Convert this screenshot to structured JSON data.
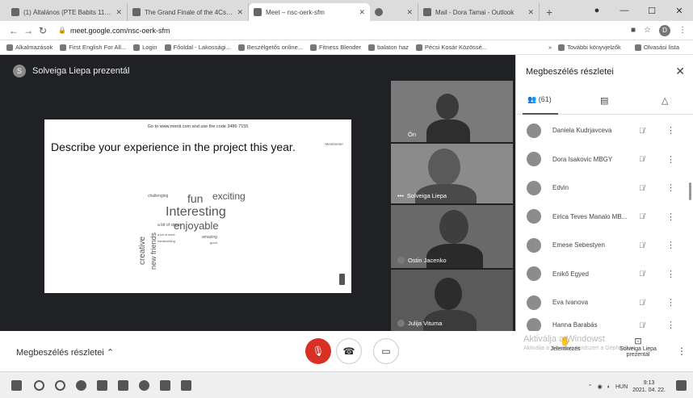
{
  "browser": {
    "tabs": [
      {
        "title": "(1) Általános (PTE Babits 11.DE ..."
      },
      {
        "title": "The Grand Finale of the 4Cs dig..."
      },
      {
        "title": "Meet – nsc-oerk-sfm"
      },
      {
        "title": ""
      },
      {
        "title": "Mail - Dora Tamai - Outlook"
      }
    ],
    "url": "meet.google.com/nsc-oerk-sfm",
    "bookmarks": [
      "Alkalmazások",
      "First English For All...",
      "Login",
      "Főoldal - Lakossági...",
      "Beszélgetős online...",
      "Fitness Blender",
      "balaton haz",
      "Pécsi Kosár Közössé..."
    ],
    "bookmarks_more": "»",
    "other_bookmarks": "További könyvjelzők",
    "reading_list": "Olvasási lista"
  },
  "meet": {
    "presenter_initial": "S",
    "presenter_label": "Solveiga Liepa prezentál",
    "slide": {
      "top_text": "Go to www.menti.com and use the code 3486 7155",
      "brand": "Mentimeter",
      "title": "Describe your experience in the project this year.",
      "words": [
        {
          "text": "fun",
          "size": 14
        },
        {
          "text": "exciting",
          "size": 12
        },
        {
          "text": "Interesting",
          "size": 16
        },
        {
          "text": "enjoyable",
          "size": 13
        },
        {
          "text": "creative",
          "size": 10
        },
        {
          "text": "new friends",
          "size": 9
        },
        {
          "text": "challenging",
          "size": 5
        },
        {
          "text": "a bit of stress",
          "size": 5
        },
        {
          "text": "amazing",
          "size": 5
        },
        {
          "text": "a lot of work",
          "size": 4
        },
        {
          "text": "hardworking",
          "size": 4
        },
        {
          "text": "good",
          "size": 4
        }
      ]
    },
    "tiles": [
      {
        "name": "Ön"
      },
      {
        "name": "Solveiga Liepa"
      },
      {
        "name": "Ostin Jacenko"
      },
      {
        "name": "Julija Vituma"
      }
    ]
  },
  "panel": {
    "title": "Megbeszélés részletei",
    "people_count": "(61)",
    "participants": [
      {
        "name": "Daniela Kudrjavceva"
      },
      {
        "name": "Dora Isakovic MBGY"
      },
      {
        "name": "Edvin"
      },
      {
        "name": "Eirica Teves Manalo MB..."
      },
      {
        "name": "Emese Sebestyen"
      },
      {
        "name": "Enikő Egyed"
      },
      {
        "name": "Eva Ivanova"
      },
      {
        "name": "Hanna Barabás"
      }
    ]
  },
  "bottom": {
    "meeting_details": "Megbeszélés részletei",
    "watermark_line1": "Aktiválja a Windowst",
    "watermark_line2": "Aktiválja a Windows rendszert a Gépházban.",
    "raise_hand": "Jelentkezés",
    "presenting_line1": "Solveiga Liepa",
    "presenting_line2": "prezentál"
  },
  "taskbar": {
    "lang": "HUN",
    "time": "9:13",
    "date": "2021. 04. 22."
  }
}
